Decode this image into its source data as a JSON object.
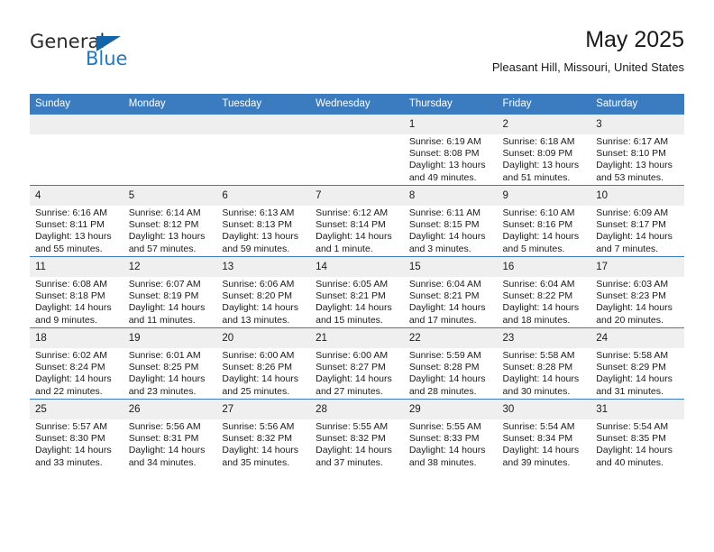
{
  "logo": {
    "word_one": "General",
    "word_two": "Blue",
    "triangle_color": "#1464aa",
    "blue_color": "#1f7ac4"
  },
  "header": {
    "title": "May 2025",
    "subtitle": "Pleasant Hill, Missouri, United States"
  },
  "theme": {
    "header_bg": "#3a7cbf",
    "daynum_bg": "#efefef",
    "row_border": "#3a7cbf",
    "text": "#1a1a1a"
  },
  "calendar": {
    "weekday_headers": [
      "Sunday",
      "Monday",
      "Tuesday",
      "Wednesday",
      "Thursday",
      "Friday",
      "Saturday"
    ],
    "weeks": [
      [
        {
          "day": "",
          "empty": true,
          "sunrise": "",
          "sunset": "",
          "daylight": ""
        },
        {
          "day": "",
          "empty": true,
          "sunrise": "",
          "sunset": "",
          "daylight": ""
        },
        {
          "day": "",
          "empty": true,
          "sunrise": "",
          "sunset": "",
          "daylight": ""
        },
        {
          "day": "",
          "empty": true,
          "sunrise": "",
          "sunset": "",
          "daylight": ""
        },
        {
          "day": "1",
          "sunrise": "Sunrise: 6:19 AM",
          "sunset": "Sunset: 8:08 PM",
          "daylight": "Daylight: 13 hours and 49 minutes."
        },
        {
          "day": "2",
          "sunrise": "Sunrise: 6:18 AM",
          "sunset": "Sunset: 8:09 PM",
          "daylight": "Daylight: 13 hours and 51 minutes."
        },
        {
          "day": "3",
          "sunrise": "Sunrise: 6:17 AM",
          "sunset": "Sunset: 8:10 PM",
          "daylight": "Daylight: 13 hours and 53 minutes."
        }
      ],
      [
        {
          "day": "4",
          "sunrise": "Sunrise: 6:16 AM",
          "sunset": "Sunset: 8:11 PM",
          "daylight": "Daylight: 13 hours and 55 minutes."
        },
        {
          "day": "5",
          "sunrise": "Sunrise: 6:14 AM",
          "sunset": "Sunset: 8:12 PM",
          "daylight": "Daylight: 13 hours and 57 minutes."
        },
        {
          "day": "6",
          "sunrise": "Sunrise: 6:13 AM",
          "sunset": "Sunset: 8:13 PM",
          "daylight": "Daylight: 13 hours and 59 minutes."
        },
        {
          "day": "7",
          "sunrise": "Sunrise: 6:12 AM",
          "sunset": "Sunset: 8:14 PM",
          "daylight": "Daylight: 14 hours and 1 minute."
        },
        {
          "day": "8",
          "sunrise": "Sunrise: 6:11 AM",
          "sunset": "Sunset: 8:15 PM",
          "daylight": "Daylight: 14 hours and 3 minutes."
        },
        {
          "day": "9",
          "sunrise": "Sunrise: 6:10 AM",
          "sunset": "Sunset: 8:16 PM",
          "daylight": "Daylight: 14 hours and 5 minutes."
        },
        {
          "day": "10",
          "sunrise": "Sunrise: 6:09 AM",
          "sunset": "Sunset: 8:17 PM",
          "daylight": "Daylight: 14 hours and 7 minutes."
        }
      ],
      [
        {
          "day": "11",
          "sunrise": "Sunrise: 6:08 AM",
          "sunset": "Sunset: 8:18 PM",
          "daylight": "Daylight: 14 hours and 9 minutes."
        },
        {
          "day": "12",
          "sunrise": "Sunrise: 6:07 AM",
          "sunset": "Sunset: 8:19 PM",
          "daylight": "Daylight: 14 hours and 11 minutes."
        },
        {
          "day": "13",
          "sunrise": "Sunrise: 6:06 AM",
          "sunset": "Sunset: 8:20 PM",
          "daylight": "Daylight: 14 hours and 13 minutes."
        },
        {
          "day": "14",
          "sunrise": "Sunrise: 6:05 AM",
          "sunset": "Sunset: 8:21 PM",
          "daylight": "Daylight: 14 hours and 15 minutes."
        },
        {
          "day": "15",
          "sunrise": "Sunrise: 6:04 AM",
          "sunset": "Sunset: 8:21 PM",
          "daylight": "Daylight: 14 hours and 17 minutes."
        },
        {
          "day": "16",
          "sunrise": "Sunrise: 6:04 AM",
          "sunset": "Sunset: 8:22 PM",
          "daylight": "Daylight: 14 hours and 18 minutes."
        },
        {
          "day": "17",
          "sunrise": "Sunrise: 6:03 AM",
          "sunset": "Sunset: 8:23 PM",
          "daylight": "Daylight: 14 hours and 20 minutes."
        }
      ],
      [
        {
          "day": "18",
          "sunrise": "Sunrise: 6:02 AM",
          "sunset": "Sunset: 8:24 PM",
          "daylight": "Daylight: 14 hours and 22 minutes."
        },
        {
          "day": "19",
          "sunrise": "Sunrise: 6:01 AM",
          "sunset": "Sunset: 8:25 PM",
          "daylight": "Daylight: 14 hours and 23 minutes."
        },
        {
          "day": "20",
          "sunrise": "Sunrise: 6:00 AM",
          "sunset": "Sunset: 8:26 PM",
          "daylight": "Daylight: 14 hours and 25 minutes."
        },
        {
          "day": "21",
          "sunrise": "Sunrise: 6:00 AM",
          "sunset": "Sunset: 8:27 PM",
          "daylight": "Daylight: 14 hours and 27 minutes."
        },
        {
          "day": "22",
          "sunrise": "Sunrise: 5:59 AM",
          "sunset": "Sunset: 8:28 PM",
          "daylight": "Daylight: 14 hours and 28 minutes."
        },
        {
          "day": "23",
          "sunrise": "Sunrise: 5:58 AM",
          "sunset": "Sunset: 8:28 PM",
          "daylight": "Daylight: 14 hours and 30 minutes."
        },
        {
          "day": "24",
          "sunrise": "Sunrise: 5:58 AM",
          "sunset": "Sunset: 8:29 PM",
          "daylight": "Daylight: 14 hours and 31 minutes."
        }
      ],
      [
        {
          "day": "25",
          "sunrise": "Sunrise: 5:57 AM",
          "sunset": "Sunset: 8:30 PM",
          "daylight": "Daylight: 14 hours and 33 minutes."
        },
        {
          "day": "26",
          "sunrise": "Sunrise: 5:56 AM",
          "sunset": "Sunset: 8:31 PM",
          "daylight": "Daylight: 14 hours and 34 minutes."
        },
        {
          "day": "27",
          "sunrise": "Sunrise: 5:56 AM",
          "sunset": "Sunset: 8:32 PM",
          "daylight": "Daylight: 14 hours and 35 minutes."
        },
        {
          "day": "28",
          "sunrise": "Sunrise: 5:55 AM",
          "sunset": "Sunset: 8:32 PM",
          "daylight": "Daylight: 14 hours and 37 minutes."
        },
        {
          "day": "29",
          "sunrise": "Sunrise: 5:55 AM",
          "sunset": "Sunset: 8:33 PM",
          "daylight": "Daylight: 14 hours and 38 minutes."
        },
        {
          "day": "30",
          "sunrise": "Sunrise: 5:54 AM",
          "sunset": "Sunset: 8:34 PM",
          "daylight": "Daylight: 14 hours and 39 minutes."
        },
        {
          "day": "31",
          "sunrise": "Sunrise: 5:54 AM",
          "sunset": "Sunset: 8:35 PM",
          "daylight": "Daylight: 14 hours and 40 minutes."
        }
      ]
    ]
  }
}
